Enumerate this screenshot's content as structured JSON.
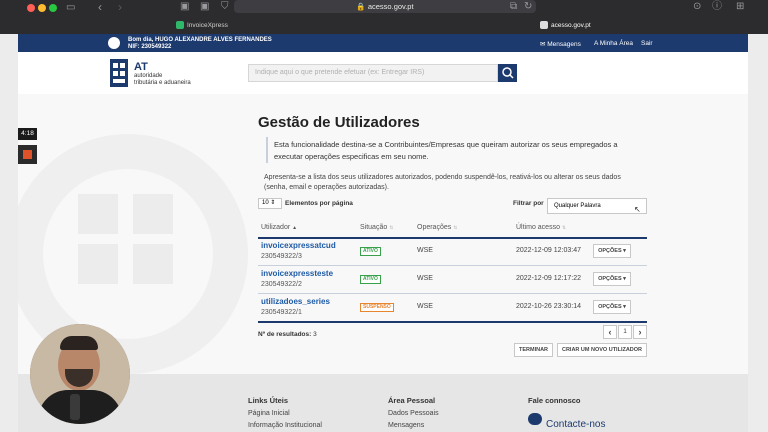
{
  "browser": {
    "url": "acesso.gov.pt",
    "tabs": [
      {
        "label": "InvoiceXpress"
      },
      {
        "label": "acesso.gov.pt"
      }
    ]
  },
  "topbar": {
    "greeting": "Bom dia, HUGO ALEXANDRE ALVES FERNANDES",
    "nif": "NIF: 230549322",
    "links": [
      "Mensagens",
      "A Minha Área",
      "Sair"
    ]
  },
  "header": {
    "logo_title": "AT",
    "logo_line1": "autoridade",
    "logo_line2": "tributária e aduaneira",
    "search_placeholder": "Indique aqui o que pretende efetuar (ex: Entregar IRS)"
  },
  "recording": {
    "timer": "4:18"
  },
  "page": {
    "title": "Gestão de Utilizadores",
    "intro1": "Esta funcionalidade destina-se a Contribuintes/Empresas que queiram autorizar os seus empregados a",
    "intro2": "executar operações especificas em seu nome.",
    "desc1": "Apresenta-se a lista dos seus utilizadores autorizados, podendo suspendê-los, reativá-los ou alterar os seus dados",
    "desc2": "(senha, email e operações autorizadas).",
    "page_size": "10",
    "page_size_label": "Elementos por página",
    "filter_label": "Filtrar por",
    "filter_value": "Qualquer Palavra"
  },
  "table": {
    "headers": [
      "Utilizador",
      "Situação",
      "Operações",
      "Último acesso"
    ],
    "rows": [
      {
        "user": "invoicexpressatcud",
        "id": "230549322/3",
        "status": "ATIVO",
        "ops": "WSE",
        "last": "2022-12-09 12:03:47",
        "action": "OPÇÕES ▾"
      },
      {
        "user": "invoicexpressteste",
        "id": "230549322/2",
        "status": "ATIVO",
        "ops": "WSE",
        "last": "2022-12-09 12:17:22",
        "action": "OPÇÕES ▾"
      },
      {
        "user": "utilizadoes_series",
        "id": "230549322/1",
        "status": "SUSPENSO",
        "ops": "WSE",
        "last": "2022-10-26 23:30:14",
        "action": "OPÇÕES ▾"
      }
    ]
  },
  "results": {
    "label": "Nº de resultados:",
    "count": "3"
  },
  "pager": {
    "prev": "‹",
    "page": "1",
    "next": "›"
  },
  "actions": {
    "terminate": "TERMINAR",
    "create": "CRIAR UM NOVO UTILIZADOR"
  },
  "footer": {
    "col1_title": "Links Úteis",
    "col1_items": [
      "Página Inicial",
      "Informação Institucional"
    ],
    "col2_title": "Área Pessoal",
    "col2_items": [
      "Dados Pessoais",
      "Mensagens"
    ],
    "col3_title": "Fale connosco",
    "col3_contact": "Contacte-nos"
  },
  "colors": {
    "gov_blue": "#1d3a6e",
    "link_blue": "#1e5aa6",
    "active_green": "#3aa14b",
    "suspended_orange": "#e8852f"
  }
}
